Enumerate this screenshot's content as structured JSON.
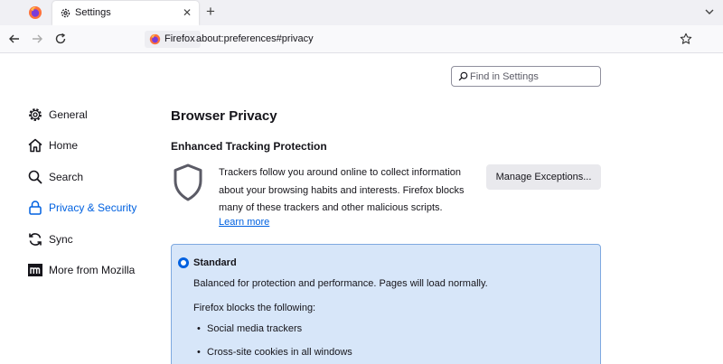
{
  "browser": {
    "tab": {
      "title": "Settings",
      "close_label": "✕"
    },
    "new_tab_label": "+",
    "identity_label": "Firefox",
    "url": "about:preferences#privacy"
  },
  "search": {
    "placeholder": "Find in Settings",
    "value": ""
  },
  "sidebar": {
    "items": [
      {
        "label": "General",
        "icon": "gear-icon"
      },
      {
        "label": "Home",
        "icon": "home-icon"
      },
      {
        "label": "Search",
        "icon": "search-icon"
      },
      {
        "label": "Privacy & Security",
        "icon": "lock-icon",
        "active": true
      },
      {
        "label": "Sync",
        "icon": "sync-icon"
      },
      {
        "label": "More from Mozilla",
        "icon": "mozilla-icon"
      }
    ]
  },
  "main": {
    "section_title": "Browser Privacy",
    "etp": {
      "heading": "Enhanced Tracking Protection",
      "description": "Trackers follow you around online to collect information about your browsing habits and interests. Firefox blocks many of these trackers and other malicious scripts.",
      "learn_more": "Learn more",
      "manage_button": "Manage Exceptions..."
    },
    "standard": {
      "label": "Standard",
      "description": "Balanced for protection and performance. Pages will load normally.",
      "blocks_intro": "Firefox blocks the following:",
      "items": [
        "Social media trackers",
        "Cross-site cookies in all windows"
      ]
    }
  },
  "colors": {
    "accent": "#0061e0",
    "card_bg": "#d7e6f9",
    "card_border": "#7fa9e0"
  }
}
